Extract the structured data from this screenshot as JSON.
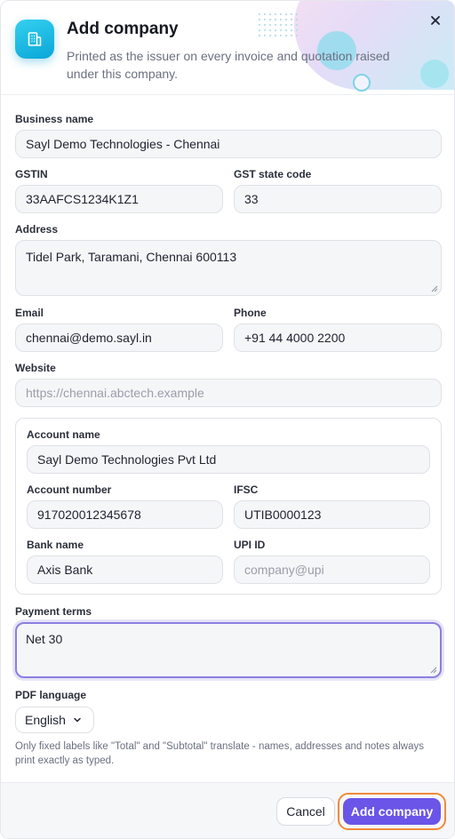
{
  "header": {
    "title": "Add company",
    "subtitle": "Printed as the issuer on every invoice and quotation raised under this company.",
    "icon": "building-icon",
    "close_icon": "close-icon"
  },
  "form": {
    "business_name": {
      "label": "Business name",
      "value": "Sayl Demo Technologies - Chennai"
    },
    "gstin": {
      "label": "GSTIN",
      "value": "33AAFCS1234K1Z1"
    },
    "gst_state_code": {
      "label": "GST state code",
      "value": "33"
    },
    "address": {
      "label": "Address",
      "value": "Tidel Park, Taramani, Chennai 600113"
    },
    "email": {
      "label": "Email",
      "value": "chennai@demo.sayl.in"
    },
    "phone": {
      "label": "Phone",
      "value": "+91 44 4000 2200"
    },
    "website": {
      "label": "Website",
      "value": "",
      "placeholder": "https://chennai.abctech.example"
    },
    "bank": {
      "account_name": {
        "label": "Account name",
        "value": "Sayl Demo Technologies Pvt Ltd"
      },
      "account_number": {
        "label": "Account number",
        "value": "917020012345678"
      },
      "ifsc": {
        "label": "IFSC",
        "value": "UTIB0000123"
      },
      "bank_name": {
        "label": "Bank name",
        "value": "Axis Bank"
      },
      "upi_id": {
        "label": "UPI ID",
        "value": "",
        "placeholder": "company@upi"
      }
    },
    "payment_terms": {
      "label": "Payment terms",
      "value": "Net 30"
    },
    "pdf_language": {
      "label": "PDF language",
      "selected": "English",
      "hint": "Only fixed labels like \"Total\" and \"Subtotal\" translate - names, addresses and notes always print exactly as typed."
    }
  },
  "footer": {
    "cancel_label": "Cancel",
    "submit_label": "Add company"
  },
  "colors": {
    "primary": "#6a55e8",
    "focus_ring": "#8b7fe0",
    "icon_gradient_start": "#35d0ef",
    "icon_gradient_end": "#0aa6d8",
    "submit_outline": "#f08a3a"
  }
}
